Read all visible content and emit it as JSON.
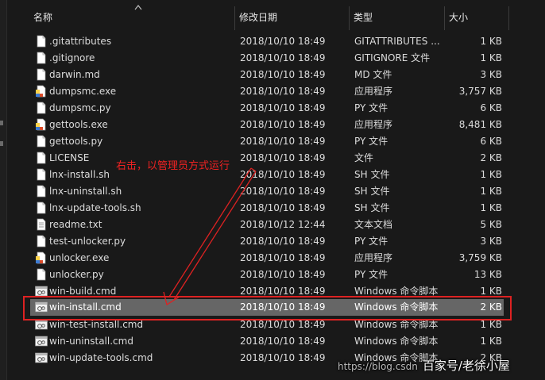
{
  "columns": {
    "name": "名称",
    "date": "修改日期",
    "type": "类型",
    "size": "大小"
  },
  "files": [
    {
      "name": ".gitattributes",
      "date": "2018/10/10 18:49",
      "type": "GITATTRIBUTES ...",
      "size": "1 KB",
      "icon": "document-icon"
    },
    {
      "name": ".gitignore",
      "date": "2018/10/10 18:49",
      "type": "GITIGNORE 文件",
      "size": "1 KB",
      "icon": "document-icon"
    },
    {
      "name": "darwin.md",
      "date": "2018/10/10 18:49",
      "type": "MD 文件",
      "size": "3 KB",
      "icon": "document-icon"
    },
    {
      "name": "dumpsmc.exe",
      "date": "2018/10/10 18:49",
      "type": "应用程序",
      "size": "3,757 KB",
      "icon": "exe-icon"
    },
    {
      "name": "dumpsmc.py",
      "date": "2018/10/10 18:49",
      "type": "PY 文件",
      "size": "6 KB",
      "icon": "document-icon"
    },
    {
      "name": "gettools.exe",
      "date": "2018/10/10 18:49",
      "type": "应用程序",
      "size": "8,481 KB",
      "icon": "exe-icon"
    },
    {
      "name": "gettools.py",
      "date": "2018/10/10 18:49",
      "type": "PY 文件",
      "size": "6 KB",
      "icon": "document-icon"
    },
    {
      "name": "LICENSE",
      "date": "2018/10/10 18:49",
      "type": "文件",
      "size": "2 KB",
      "icon": "document-icon"
    },
    {
      "name": "lnx-install.sh",
      "date": "2018/10/10 18:49",
      "type": "SH 文件",
      "size": "1 KB",
      "icon": "document-icon"
    },
    {
      "name": "lnx-uninstall.sh",
      "date": "2018/10/10 18:49",
      "type": "SH 文件",
      "size": "1 KB",
      "icon": "document-icon"
    },
    {
      "name": "lnx-update-tools.sh",
      "date": "2018/10/10 18:49",
      "type": "SH 文件",
      "size": "1 KB",
      "icon": "document-icon"
    },
    {
      "name": "readme.txt",
      "date": "2018/10/12 12:44",
      "type": "文本文档",
      "size": "5 KB",
      "icon": "text-file-icon"
    },
    {
      "name": "test-unlocker.py",
      "date": "2018/10/10 18:49",
      "type": "PY 文件",
      "size": "3 KB",
      "icon": "document-icon"
    },
    {
      "name": "unlocker.exe",
      "date": "2018/10/10 18:49",
      "type": "应用程序",
      "size": "3,759 KB",
      "icon": "exe-icon"
    },
    {
      "name": "unlocker.py",
      "date": "2018/10/10 18:49",
      "type": "PY 文件",
      "size": "13 KB",
      "icon": "document-icon"
    },
    {
      "name": "win-build.cmd",
      "date": "2018/10/10 18:49",
      "type": "Windows 命令脚本",
      "size": "1 KB",
      "icon": "cmd-script-icon"
    },
    {
      "name": "win-install.cmd",
      "date": "2018/10/10 18:49",
      "type": "Windows 命令脚本",
      "size": "2 KB",
      "icon": "cmd-script-icon",
      "selected": true
    },
    {
      "name": "win-test-install.cmd",
      "date": "2018/10/10 18:49",
      "type": "Windows 命令脚本",
      "size": "1 KB",
      "icon": "cmd-script-icon"
    },
    {
      "name": "win-uninstall.cmd",
      "date": "2018/10/10 18:49",
      "type": "Windows 命令脚本",
      "size": "1 KB",
      "icon": "cmd-script-icon"
    },
    {
      "name": "win-update-tools.cmd",
      "date": "2018/10/10 18:49",
      "type": "Windows 命令脚本",
      "size": "2 KB",
      "icon": "cmd-script-icon"
    }
  ],
  "annotation": {
    "text": "右击，以管理员方式运行",
    "color": "#ee2222"
  },
  "watermark": {
    "url": "https://blog.csdn",
    "text": "百家号/老徐小屋"
  },
  "colors": {
    "background": "#191919",
    "selected_row": "#666666",
    "highlight": "#dd2222",
    "text": "#dcdcdc"
  }
}
